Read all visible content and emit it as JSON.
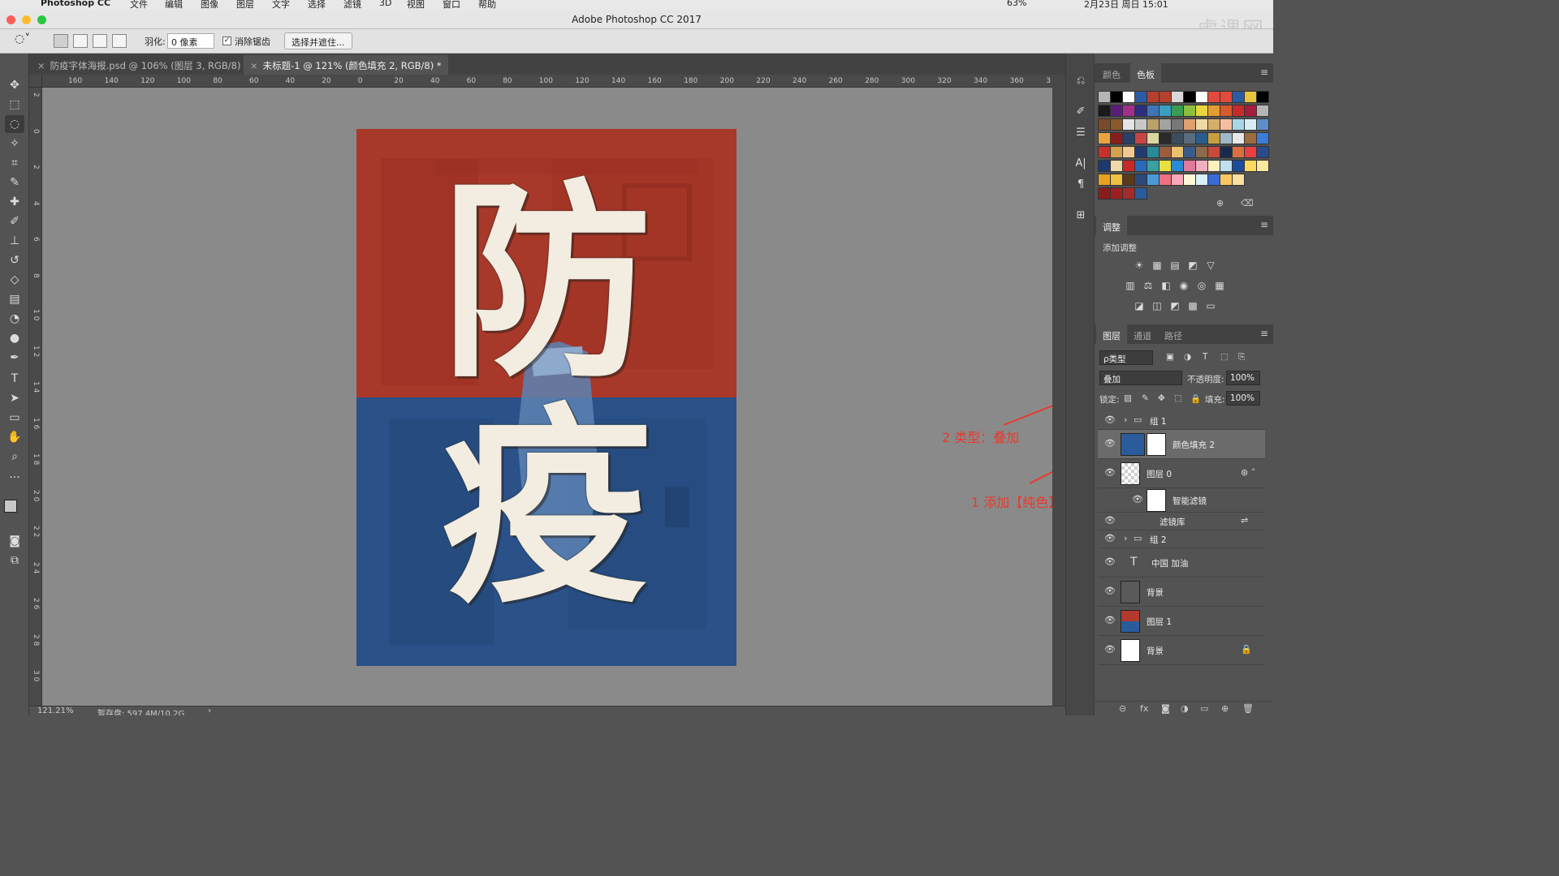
{
  "os_menubar": {
    "apple_glyph": "",
    "app_name": "Photoshop CC",
    "menus": [
      "文件",
      "编辑",
      "图像",
      "图层",
      "文字",
      "选择",
      "滤镜",
      "3D",
      "视图",
      "窗口",
      "帮助"
    ],
    "battery": "63%",
    "datetime": "2月23日 周日 15:01"
  },
  "window": {
    "title": "Adobe Photoshop CC 2017",
    "watermark": "虎课网"
  },
  "options_bar": {
    "feather_label": "羽化:",
    "feather_value": "0 像素",
    "antialias_label": "消除锯齿",
    "antialias_checked": "✓",
    "select_mask_button": "选择并遮住..."
  },
  "document_tabs": [
    {
      "label": "防疫字体海报.psd @ 106% (图层 3, RGB/8) *",
      "close": "×"
    },
    {
      "label": "未标题-1 @ 121% (颜色填充 2, RGB/8) *",
      "close": "×"
    }
  ],
  "ruler": {
    "h_ticks": [
      "160",
      "140",
      "120",
      "100",
      "80",
      "60",
      "40",
      "20",
      "0",
      "20",
      "40",
      "60",
      "80",
      "100",
      "120",
      "140",
      "160",
      "180",
      "200",
      "220",
      "240",
      "260",
      "280",
      "300",
      "320",
      "340",
      "360",
      "3"
    ],
    "v_ticks": [
      "2",
      "0",
      "2",
      "4",
      "6",
      "8",
      "1 0",
      "1 2",
      "1 4",
      "1 6",
      "1 8",
      "2 0",
      "2 2",
      "2 4",
      "2 6",
      "2 8",
      "3 0"
    ]
  },
  "canvas": {
    "poster_top_char": "防",
    "poster_bottom_char": "疫",
    "colors": {
      "red": "#a8392a",
      "blue": "#2a5289",
      "letters": "#f2ede0",
      "workspace": "#8a8a8a"
    }
  },
  "status": {
    "zoom": "121.21%",
    "scratch": "暂存盘: 597.4M/10.2G",
    "arrow": "›"
  },
  "swatches_panel": {
    "tabs": [
      "颜色",
      "色板"
    ],
    "menu": "≡",
    "rows": [
      [
        "#b5b5b5",
        "#000000",
        "#ffffff",
        "#2b5ca3",
        "#b5402d",
        "#b5402d",
        "#d9d9d9",
        "#000000",
        "#ffffff",
        "#e24a3d",
        "#e24a3d",
        "#2b5ca3",
        "#e8c340",
        "#000000"
      ],
      [
        "#1a1a1a",
        "#5a1e7a",
        "#a22d8c",
        "#2c2f80",
        "#3f74b8",
        "#3b9fbf",
        "#3a9d54",
        "#8cbf3e",
        "#e8d63d",
        "#e39b34",
        "#d85a2d",
        "#c72b2b",
        "#a61c3c",
        "#b5b5b5"
      ],
      [
        "#7a4b2a",
        "#8a5a2a",
        "#e4e4e4",
        "#c8c8c8",
        "#bca06a",
        "#a2a2a2",
        "#787878",
        "#e0a070",
        "#efd9a6",
        "#d6ae6a",
        "#f4c0a0",
        "#a8d8e8",
        "#d8eef4",
        "#5e8ec8"
      ],
      [
        "#e8a340",
        "#8b1c1c",
        "#2a3f66",
        "#c84545",
        "#d8d8a0",
        "#2a2a2a",
        "#3c4c5c",
        "#5c6c7c",
        "#2a5c8c",
        "#c8a040",
        "#a0b8c8",
        "#e8e8e8",
        "#9c6c3c",
        "#3c7cd8"
      ],
      [
        "#c8302a",
        "#d4a24c",
        "#f0c890",
        "#1e3c70",
        "#2a8a9a",
        "#9c5c3c",
        "#e8c070",
        "#3a5a8a",
        "#8a6a4a",
        "#c84a3a",
        "#1a2a4a",
        "#d87040",
        "#e84040",
        "#2a4a8a"
      ],
      [
        "#1c3a6e",
        "#f0d8a8",
        "#c82a2a",
        "#2a6ab8",
        "#3aa0a0",
        "#e8e040",
        "#2a8ad8",
        "#e07a9a",
        "#f0b0c0",
        "#fff0c0",
        "#c0e0f0",
        "#1c4c9c",
        "#ffd860",
        "#f8e8a0"
      ],
      [
        "#e8a020",
        "#f0c040",
        "#5a3a1a",
        "#2a4a7a",
        "#4a9ad8",
        "#f07080",
        "#f8a8b8",
        "#fff8d8",
        "#d8f0f8",
        "#3a6ad8",
        "#f8c860",
        "#fce0a0"
      ],
      [
        "#8b1c1c",
        "#9c2020",
        "#a52a2a",
        "#2a5c9c"
      ]
    ]
  },
  "adjustments_panel": {
    "tab": "调整",
    "menu": "≡",
    "label": "添加调整",
    "row1": [
      "☀",
      "▦",
      "▤",
      "◩",
      "▽"
    ],
    "row2": [
      "▥",
      "⚖",
      "◧",
      "◉",
      "◎",
      "▦"
    ],
    "row3": [
      "◪",
      "◫",
      "◩",
      "▩",
      "▭"
    ]
  },
  "layers_panel": {
    "tabs": [
      "图层",
      "通道",
      "路径"
    ],
    "menu": "≡",
    "kind_filter": "ρ类型",
    "filter_icons": [
      "▣",
      "◑",
      "T",
      "⬚",
      "⎘"
    ],
    "blend_mode": "叠加",
    "opacity_label": "不透明度:",
    "opacity_value": "100%",
    "lock_label": "锁定:",
    "lock_icons": [
      "▨",
      "✎",
      "✥",
      "⬚",
      "🔒"
    ],
    "fill_label": "填充:",
    "fill_value": "100%",
    "layers": [
      {
        "name": "组 1",
        "kind": "group",
        "eye": "👁",
        "arrow": "›",
        "icon": "▭"
      },
      {
        "name": "颜色填充 2",
        "kind": "fill",
        "eye": "👁",
        "selected": true,
        "color": "#2a5c9c"
      },
      {
        "name": "图层 0",
        "kind": "smart",
        "eye": "👁",
        "right_icon": "⊛ ˄"
      },
      {
        "name": "智能滤镜",
        "kind": "smartfilter",
        "eye": "👁"
      },
      {
        "name": "滤镜库",
        "kind": "filter",
        "eye": "👁",
        "right_icon": "⇌"
      },
      {
        "name": "组 2",
        "kind": "group",
        "eye": "👁",
        "arrow": "›",
        "icon": "▭"
      },
      {
        "name": "中国 加油",
        "kind": "text",
        "eye": "👁",
        "icon": "T"
      },
      {
        "name": "背景",
        "kind": "smart2",
        "eye": "👁"
      },
      {
        "name": "图层 1",
        "kind": "redblue",
        "eye": "👁"
      },
      {
        "name": "背景",
        "kind": "background",
        "eye": "👁",
        "right_icon": "🔒"
      }
    ],
    "bottom_icons": [
      "⊝",
      "fx",
      "◙",
      "◑",
      "▭",
      "⊕",
      "🗑"
    ]
  },
  "annotations": {
    "a1": "2 类型：叠加",
    "a2": "1 添加【纯色】"
  }
}
